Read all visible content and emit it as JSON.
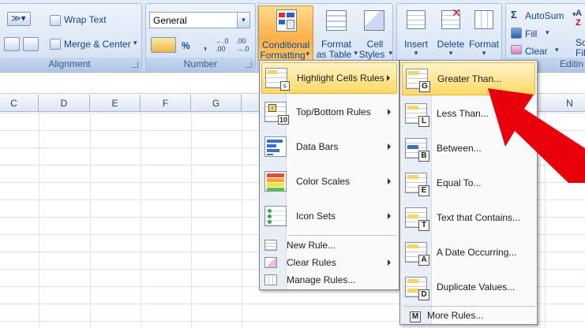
{
  "ribbon": {
    "alignment": {
      "label": "Alignment",
      "wrap_text": "Wrap Text",
      "merge_center": "Merge & Center"
    },
    "number": {
      "label": "Number",
      "format_value": "General",
      "percent": "%",
      "comma": ",",
      "inc_decimal": "←.0 .00",
      "dec_decimal": ".00 →.0"
    },
    "styles": {
      "conditional_formatting_line1": "Conditional",
      "conditional_formatting_line2": "Formatting",
      "format_as_table_line1": "Format",
      "format_as_table_line2": "as Table",
      "cell_styles_line1": "Cell",
      "cell_styles_line2": "Styles"
    },
    "cells": {
      "insert": "Insert",
      "delete": "Delete",
      "format": "Format"
    },
    "editing": {
      "label": "Editin",
      "autosum": "AutoSum",
      "fill": "Fill",
      "clear": "Clear",
      "sort_filter_line1": "So",
      "sort_filter_line2": "Filt"
    }
  },
  "columns": [
    "C",
    "D",
    "E",
    "F",
    "G",
    "N"
  ],
  "conditional_menu": {
    "items": [
      {
        "label": "Highlight Cells Rules",
        "key": "H"
      },
      {
        "label": "Top/Bottom Rules",
        "key": "T"
      },
      {
        "label": "Data Bars",
        "key": "D"
      },
      {
        "label": "Color Scales",
        "key": "S"
      },
      {
        "label": "Icon Sets",
        "key": "I"
      }
    ],
    "small_items": [
      {
        "label": "New Rule..."
      },
      {
        "label": "Clear Rules"
      },
      {
        "label": "Manage Rules..."
      }
    ],
    "top_bottom_icon_text": "10"
  },
  "highlight_submenu": {
    "items": [
      {
        "label": "Greater Than...",
        "badge": "G"
      },
      {
        "label": "Less Than...",
        "badge": "L"
      },
      {
        "label": "Between...",
        "badge": "B"
      },
      {
        "label": "Equal To...",
        "badge": "E"
      },
      {
        "label": "Text that Contains...",
        "badge": "T"
      },
      {
        "label": "A Date Occurring...",
        "badge": "A"
      },
      {
        "label": "Duplicate Values...",
        "badge": "D"
      }
    ],
    "more": {
      "label": "More Rules...",
      "badge": "M"
    }
  },
  "colors": {
    "arrow": "#e8000a",
    "highlight": "#ffd965"
  }
}
